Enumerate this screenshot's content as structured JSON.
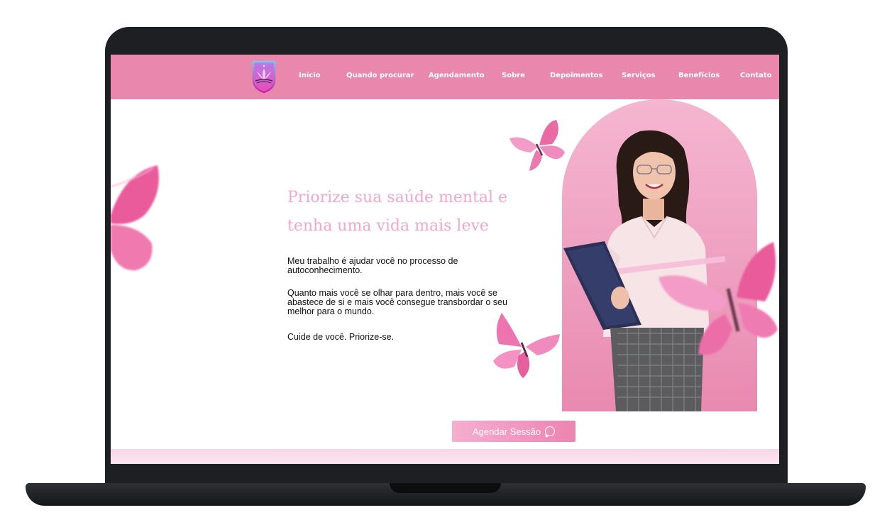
{
  "nav": {
    "items": [
      {
        "label": "Início"
      },
      {
        "label": "Quando procurar"
      },
      {
        "label": "Agendamento"
      },
      {
        "label": "Sobre"
      },
      {
        "label": "Depoimentos"
      },
      {
        "label": "Serviços"
      },
      {
        "label": "Benefícios"
      },
      {
        "label": "Contato"
      }
    ]
  },
  "hero": {
    "title": "Priorize sua saúde mental e tenha uma vida mais leve",
    "paragraphs": [
      "Meu trabalho é ajudar você no processo de autoconhecimento.",
      "Quanto mais você se olhar para dentro, mais você se abastece de si e mais você consegue transbordar o seu melhor para o mundo.",
      "Cuide de você. Priorize-se."
    ],
    "cta_label": "Agendar Sessão",
    "cta_icon": "whatsapp-icon"
  },
  "colors": {
    "navbar": "#ea87ac",
    "title": "#f7a6ca",
    "arch": "#ee9fbf",
    "cta": "#ec85ae"
  }
}
